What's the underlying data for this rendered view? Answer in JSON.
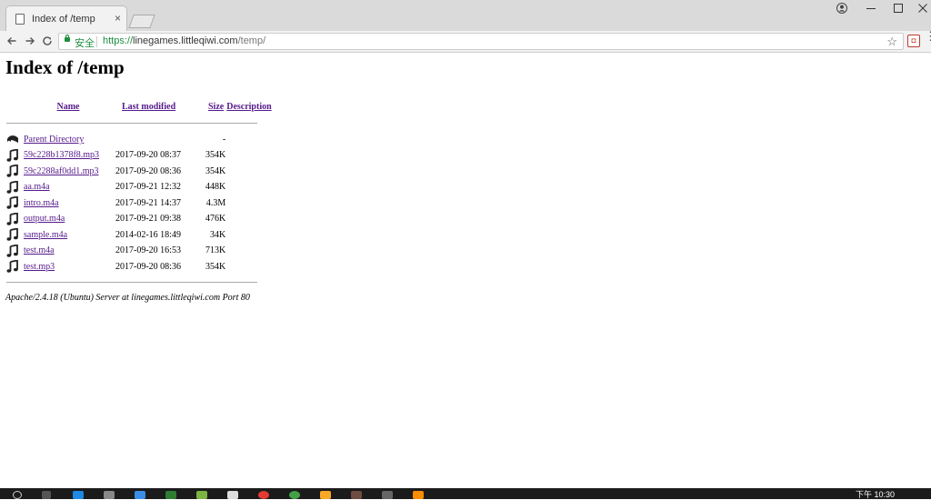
{
  "browser": {
    "tab_title": "Index of /temp",
    "tab_close": "×",
    "secure_label": "安全",
    "url_scheme": "https://",
    "url_host": "linegames.littleqiwi.com",
    "url_path": "/temp/",
    "accent": "#1e8e3e"
  },
  "page": {
    "heading": "Index of /temp",
    "columns": {
      "name": "Name",
      "last_modified": "Last modified",
      "size": "Size",
      "description": "Description"
    },
    "parent": {
      "name": "Parent Directory",
      "size": "-"
    },
    "files": [
      {
        "name": "59c228b1378f8.mp3",
        "modified": "2017-09-20 08:37",
        "size": "354K",
        "icon": "music-file-icon"
      },
      {
        "name": "59c2288af0dd1.mp3",
        "modified": "2017-09-20 08:36",
        "size": "354K",
        "icon": "music-file-icon"
      },
      {
        "name": "aa.m4a",
        "modified": "2017-09-21 12:32",
        "size": "448K",
        "icon": "music-file-icon"
      },
      {
        "name": "intro.m4a",
        "modified": "2017-09-21 14:37",
        "size": "4.3M",
        "icon": "music-file-icon"
      },
      {
        "name": "output.m4a",
        "modified": "2017-09-21 09:38",
        "size": "476K",
        "icon": "music-file-icon"
      },
      {
        "name": "sample.m4a",
        "modified": "2014-02-16 18:49",
        "size": "34K",
        "icon": "music-file-icon"
      },
      {
        "name": "test.m4a",
        "modified": "2017-09-20 16:53",
        "size": "713K",
        "icon": "music-file-icon"
      },
      {
        "name": "test.mp3",
        "modified": "2017-09-20 08:36",
        "size": "354K",
        "icon": "music-file-icon"
      }
    ],
    "footer": "Apache/2.4.18 (Ubuntu) Server at linegames.littleqiwi.com Port 80"
  },
  "taskbar": {
    "clock_ampm": "下午",
    "clock_time": "10:30"
  }
}
